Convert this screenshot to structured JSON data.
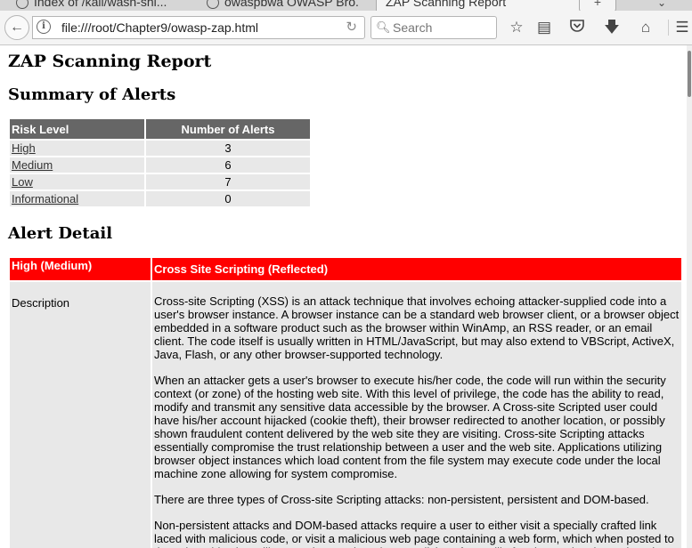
{
  "browser": {
    "tabs": [
      {
        "title": "Index of /kali/wasn-shi..."
      },
      {
        "title": "owaspbwa OWASP Bro..."
      },
      {
        "title": "ZAP Scanning Report"
      }
    ],
    "url": "file:///root/Chapter9/owasp-zap.html",
    "search_placeholder": "Search"
  },
  "report": {
    "title": "ZAP Scanning Report",
    "summary_heading": "Summary of Alerts",
    "summary_table": {
      "headers": [
        "Risk Level",
        "Number of Alerts"
      ],
      "rows": [
        {
          "level": "High",
          "count": "3"
        },
        {
          "level": "Medium",
          "count": "6"
        },
        {
          "level": "Low",
          "count": "7"
        },
        {
          "level": "Informational",
          "count": "0"
        }
      ]
    },
    "detail_heading": "Alert Detail",
    "alert": {
      "risk": "High (Medium)",
      "name": "Cross Site Scripting (Reflected)",
      "description_label": "Description",
      "paragraphs": [
        "Cross-site Scripting (XSS) is an attack technique that involves echoing attacker-supplied code into a user's browser instance. A browser instance can be a standard web browser client, or a browser object embedded in a software product such as the browser within WinAmp, an RSS reader, or an email client. The code itself is usually written in HTML/JavaScript, but may also extend to VBScript, ActiveX, Java, Flash, or any other browser-supported technology.",
        "When an attacker gets a user's browser to execute his/her code, the code will run within the security context (or zone) of the hosting web site. With this level of privilege, the code has the ability to read, modify and transmit any sensitive data accessible by the browser. A Cross-site Scripted user could have his/her account hijacked (cookie theft), their browser redirected to another location, or possibly shown fraudulent content delivered by the web site they are visiting. Cross-site Scripting attacks essentially compromise the trust relationship between a user and the web site. Applications utilizing browser object instances which load content from the file system may execute code under the local machine zone allowing for system compromise.",
        "There are three types of Cross-site Scripting attacks: non-persistent, persistent and DOM-based.",
        "Non-persistent attacks and DOM-based attacks require a user to either visit a specially crafted link laced with malicious code, or visit a malicious web page containing a web form, which when posted to the vulnerable site, will mount the attack. Using a malicious form will oftentimes take place when the"
      ]
    }
  }
}
